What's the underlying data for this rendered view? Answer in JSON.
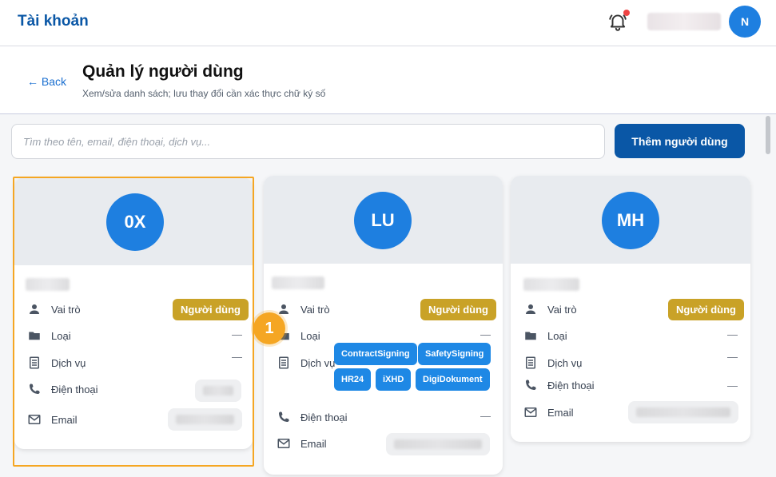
{
  "topbar": {
    "title": "Tài khoản",
    "avatar_initial": "N"
  },
  "header": {
    "back_label": "← Back",
    "title": "Quản lý người dùng",
    "subtitle": "Xem/sửa danh sách; lưu thay đổi cần xác thực chữ ký số"
  },
  "search": {
    "placeholder": "Tìm theo tên, email, điện thoại, dịch vụ...",
    "value": ""
  },
  "add_button_label": "Thêm người dùng",
  "labels": {
    "role": "Vai trò",
    "type": "Loại",
    "service": "Dịch vụ",
    "phone": "Điện thoại",
    "email": "Email",
    "empty": "—"
  },
  "users": [
    {
      "initials": "0X",
      "role": "Người dùng",
      "type": "—",
      "services": [],
      "service_empty": "—"
    },
    {
      "initials": "LU",
      "role": "Người dùng",
      "type": "—",
      "services": [
        "ContractSigning",
        "SafetySigning",
        "HR24",
        "iXHD",
        "DigiDokument"
      ],
      "phone": "—"
    },
    {
      "initials": "MH",
      "role": "Người dùng",
      "type": "—",
      "service_empty": "—",
      "phone": "—"
    }
  ],
  "step_marker": "1",
  "colors": {
    "brand": "#0a57a6",
    "avatar": "#1e7fe0",
    "role_badge": "#c9a227",
    "chip": "#1e88e5",
    "highlight": "#f5a623"
  }
}
